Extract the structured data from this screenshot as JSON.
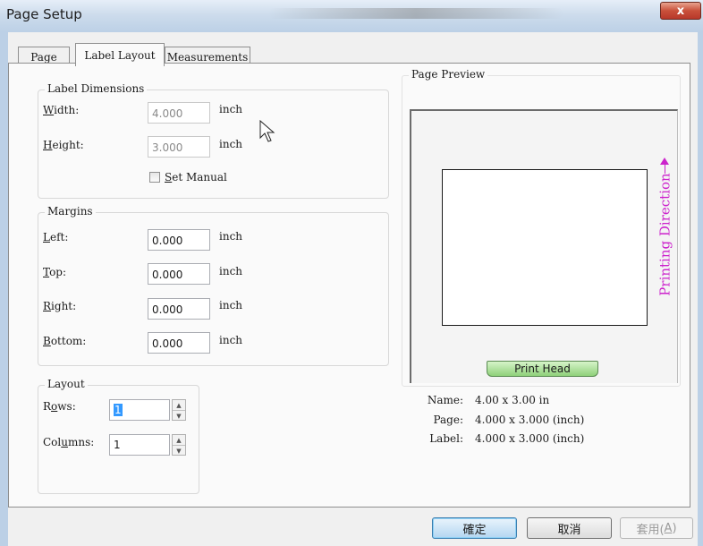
{
  "window": {
    "title": "Page Setup",
    "close_glyph": "x"
  },
  "tabs": [
    {
      "label": "Page",
      "active": false
    },
    {
      "label": "Label Layout",
      "active": true
    },
    {
      "label": "Measurements",
      "active": false
    }
  ],
  "label_dimensions": {
    "legend": "Label Dimensions",
    "width": {
      "label_u": "W",
      "label_rest": "idth:",
      "value": "4.000",
      "unit": "inch",
      "disabled": true
    },
    "height": {
      "label_u": "H",
      "label_rest": "eight:",
      "value": "3.000",
      "unit": "inch",
      "disabled": true
    },
    "set_manual": {
      "label_u": "S",
      "label_rest": "et Manual",
      "checked": false
    }
  },
  "margins": {
    "legend": "Margins",
    "left": {
      "label_u": "L",
      "label_rest": "eft:",
      "value": "0.000",
      "unit": "inch"
    },
    "top": {
      "label_u": "T",
      "label_rest": "op:",
      "value": "0.000",
      "unit": "inch"
    },
    "right": {
      "label_u": "R",
      "label_rest": "ight:",
      "value": "0.000",
      "unit": "inch"
    },
    "bottom": {
      "label_u": "B",
      "label_rest": "ottom:",
      "value": "0.000",
      "unit": "inch"
    }
  },
  "layout": {
    "legend": "Layout",
    "rows": {
      "label_pre": "R",
      "label_u": "o",
      "label_rest": "ws:",
      "value": "1"
    },
    "columns": {
      "label_pre": "Col",
      "label_u": "u",
      "label_rest": "mns:",
      "value": "1"
    }
  },
  "preview": {
    "legend": "Page Preview",
    "printing_direction": "Printing Direction",
    "print_head": "Print Head",
    "info": [
      {
        "key": "Name:",
        "value": "4.00 x 3.00 in"
      },
      {
        "key": "Page:",
        "value": "4.000 x 3.000 (inch)"
      },
      {
        "key": "Label:",
        "value": "4.000 x 3.000 (inch)"
      }
    ]
  },
  "buttons": {
    "ok": "確定",
    "cancel": "取消",
    "apply_pre": "套用(",
    "apply_u": "A",
    "apply_post": ")"
  },
  "colors": {
    "print_direction": "#cc22cc",
    "print_head": "#8fd17a",
    "selection": "#3399ff"
  }
}
